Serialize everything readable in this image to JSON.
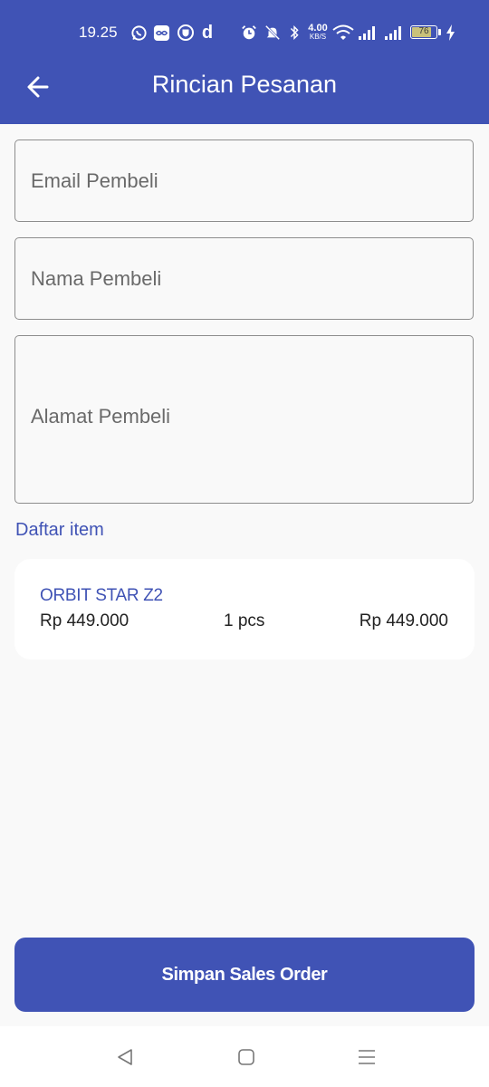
{
  "status_bar": {
    "time": "19.25",
    "net_speed_value": "4.00",
    "net_speed_unit": "KB/S",
    "battery_level": "76",
    "icons": [
      "whatsapp-icon",
      "infinity-app-icon",
      "shield-app-icon",
      "d-app-icon",
      "alarm-icon",
      "mute-icon",
      "bluetooth-icon",
      "wifi-icon",
      "signal-icon",
      "signal-icon",
      "battery-icon",
      "charging-icon"
    ]
  },
  "appbar": {
    "title": "Rincian Pesanan",
    "back_icon": "arrow-left-icon"
  },
  "form": {
    "email_placeholder": "Email Pembeli",
    "email_value": "",
    "name_placeholder": "Nama Pembeli",
    "name_value": "",
    "address_placeholder": "Alamat Pembeli",
    "address_value": ""
  },
  "items": {
    "section_label": "Daftar item",
    "list": [
      {
        "name": "ORBIT STAR Z2",
        "price": "Rp 449.000",
        "qty": "1 pcs",
        "total": "Rp 449.000"
      }
    ]
  },
  "actions": {
    "save_label": "Simpan Sales Order"
  },
  "colors": {
    "primary": "#4053b5",
    "background": "#f9f9f9",
    "card": "#ffffff"
  },
  "nav_bar": {
    "icons": [
      "nav-back-icon",
      "nav-home-icon",
      "nav-menu-icon"
    ]
  }
}
